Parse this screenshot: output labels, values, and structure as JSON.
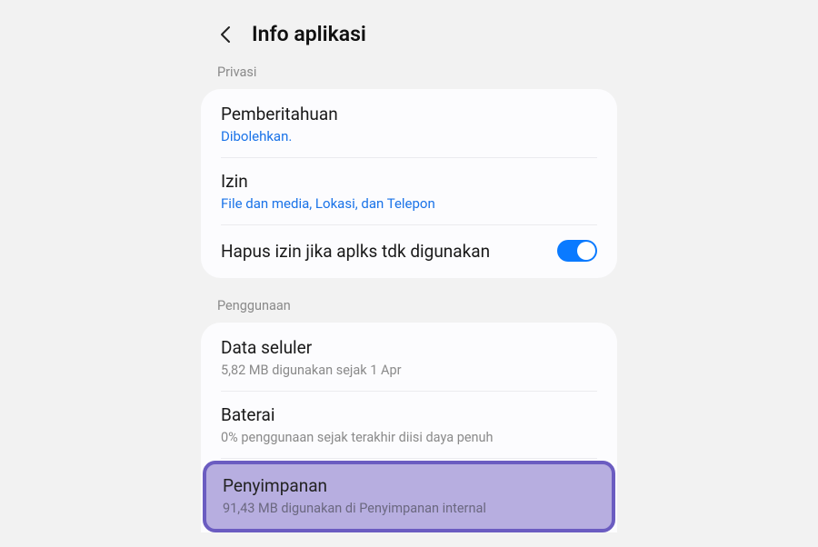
{
  "header": {
    "title": "Info aplikasi"
  },
  "sections": {
    "privacy": {
      "label": "Privasi",
      "notifications": {
        "title": "Pemberitahuan",
        "sub": "Dibolehkan."
      },
      "permissions": {
        "title": "Izin",
        "sub": "File dan media, Lokasi, dan Telepon"
      },
      "remove_perms": {
        "label": "Hapus izin jika aplks tdk digunakan"
      }
    },
    "usage": {
      "label": "Penggunaan",
      "mobile_data": {
        "title": "Data seluler",
        "sub": "5,82 MB digunakan sejak 1 Apr"
      },
      "battery": {
        "title": "Baterai",
        "sub": "0% penggunaan sejak terakhir diisi daya penuh"
      },
      "storage": {
        "title": "Penyimpanan",
        "sub": "91,43 MB digunakan di Penyimpanan internal"
      }
    }
  }
}
